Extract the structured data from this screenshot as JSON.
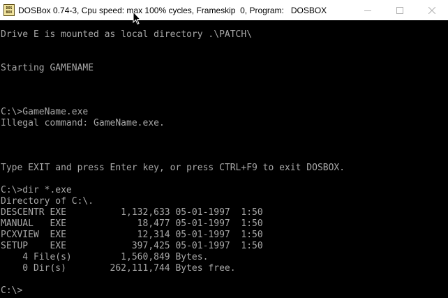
{
  "window": {
    "title": "DOSBox 0.74-3, Cpu speed: max 100% cycles, Frameskip  0, Program:   DOSBOX",
    "icon_text_top": "DOS",
    "icon_text_bottom": "BOX",
    "icon": "dosbox-icon",
    "controls": [
      "minimize-icon",
      "maximize-icon",
      "close-icon"
    ]
  },
  "console": {
    "text_color": "#a8a8a8",
    "background": "#000000",
    "lines": [
      "Drive E is mounted as local directory .\\PATCH\\",
      "",
      "",
      "Starting GAMENAME",
      "",
      "",
      "",
      "",
      "C:\\>GameName.exe",
      "Illegal command: GameName.exe.",
      "",
      "",
      "",
      "Type EXIT and press Enter key, or press CTRL+F9 to exit DOSBOX.",
      "",
      "C:\\>dir *.exe",
      "Directory of C:\\.",
      "DESCENTR EXE          1,132,633 05-01-1997  1:50",
      "MANUAL   EXE             18,477 05-01-1997  1:50",
      "PCXVIEW  EXE             12,314 05-01-1997  1:50",
      "SETUP    EXE            397,425 05-01-1997  1:50",
      "    4 File(s)         1,560,849 Bytes.",
      "    0 Dir(s)        262,111,744 Bytes free.",
      "",
      "C:\\>"
    ]
  }
}
